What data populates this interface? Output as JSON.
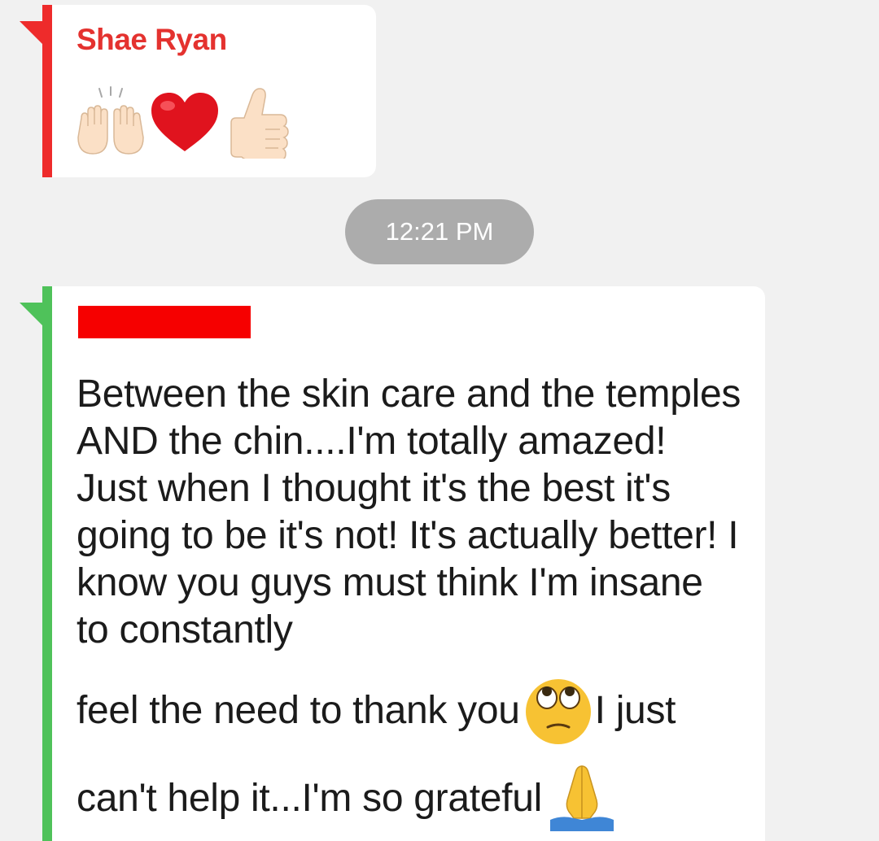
{
  "messages": [
    {
      "sender": "Shae Ryan",
      "accent_color": "#ee2b2b",
      "emojis": [
        "raising-hands-icon",
        "red-heart-icon",
        "thumbs-up-icon"
      ]
    },
    {
      "sender_redacted": true,
      "accent_color": "#4fc25a",
      "text_main": "Between the skin care and the temples AND the chin....I'm totally amazed! Just when I thought it's the best it's going to be it's not! It's actually better! I know you guys must think I'm insane to constantly",
      "text_line7_before": "feel the need to thank you",
      "text_line7_after": " I just",
      "text_line8": "can't help it...I'm so grateful ",
      "inline_emojis": [
        "face-rolling-eyes-icon",
        "folded-hands-icon"
      ]
    }
  ],
  "timestamp": "12:21 PM",
  "colors": {
    "background": "#f1f1f1",
    "bubble": "#ffffff",
    "sender_name": "#e4322f",
    "timestamp_pill": "#acacac",
    "redaction": "#f60000"
  }
}
